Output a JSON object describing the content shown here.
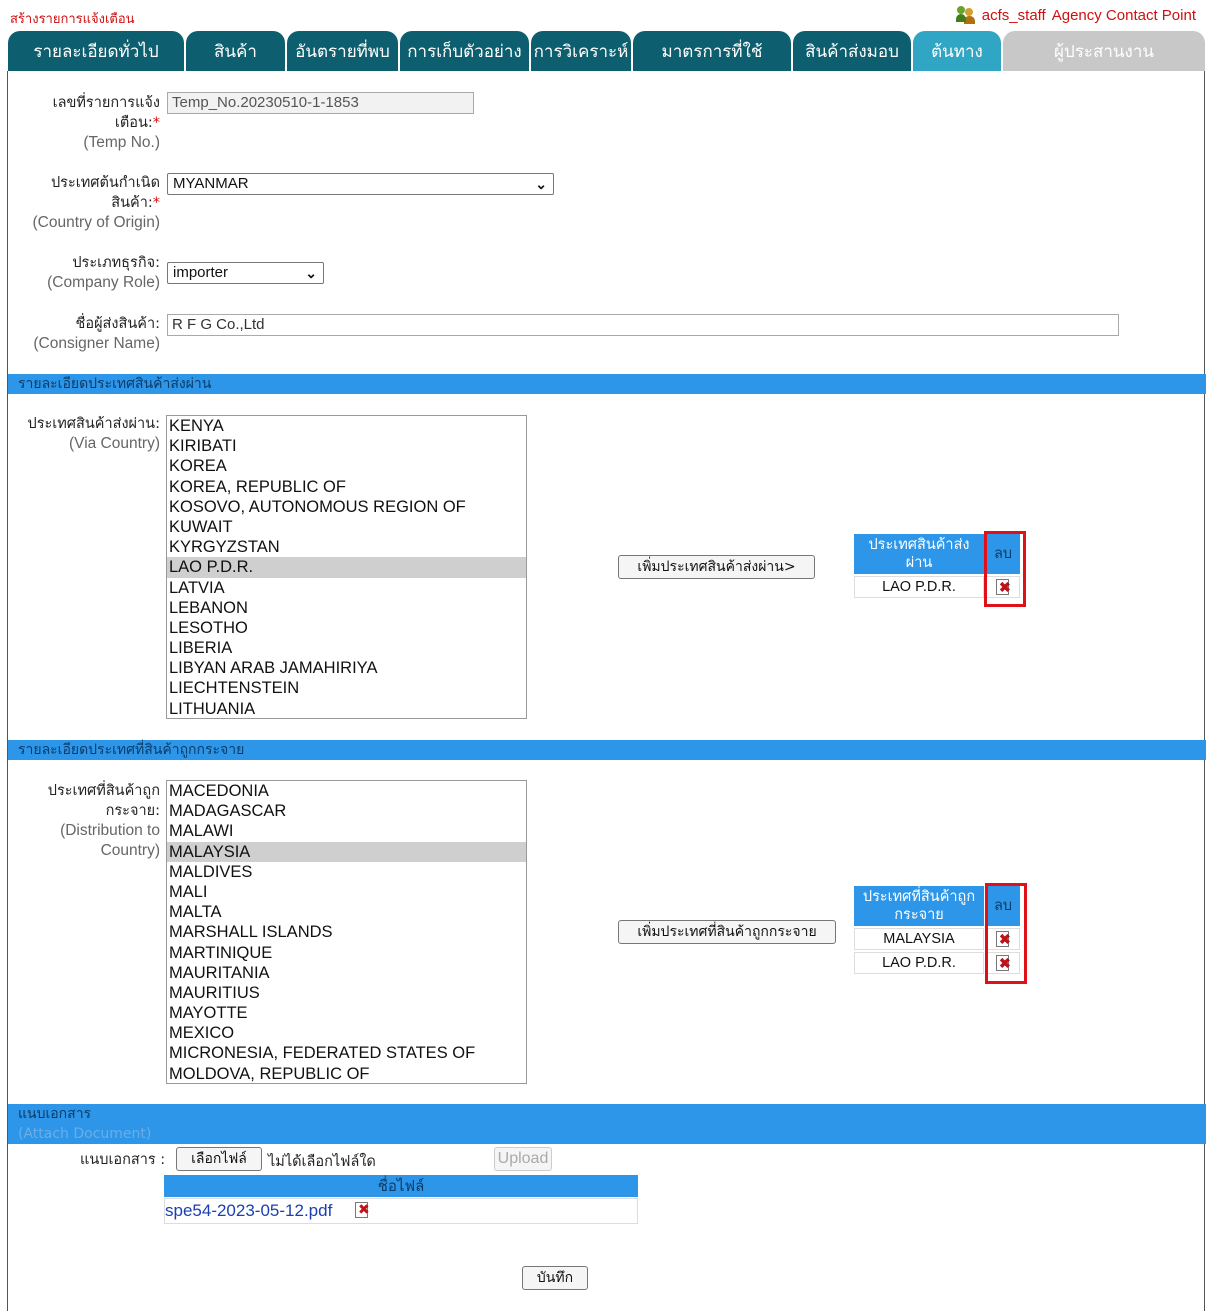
{
  "header": {
    "title": "สร้างรายการแจ้งเตือน",
    "user": "acfs_staff",
    "role": "Agency Contact Point"
  },
  "tabs": [
    {
      "label": "รายละเอียดทั่วไป",
      "state": "normal"
    },
    {
      "label": "สินค้า",
      "state": "normal"
    },
    {
      "label": "อันตรายที่พบ",
      "state": "normal"
    },
    {
      "label": "การเก็บตัวอย่าง",
      "state": "normal"
    },
    {
      "label": "การวิเคราะห์",
      "state": "normal"
    },
    {
      "label": "มาตรการที่ใช้",
      "state": "normal"
    },
    {
      "label": "สินค้าส่งมอบ",
      "state": "normal"
    },
    {
      "label": "ต้นทาง",
      "state": "active"
    },
    {
      "label": "ผู้ประสานงาน",
      "state": "disabled"
    }
  ],
  "form": {
    "temp_no": {
      "label_th": "เลขที่รายการแจ้งเตือน",
      "label_en": "(Temp No.)",
      "value": "Temp_No.20230510-1-1853"
    },
    "origin": {
      "label_th": "ประเทศต้นกำเนิดสินค้า",
      "label_en": "(Country of Origin)",
      "value": "MYANMAR"
    },
    "role": {
      "label_th": "ประเภทธุรกิจ",
      "label_en": "(Company Role)",
      "value": "importer"
    },
    "consigner": {
      "label_th": "ชื่อผู้ส่งสินค้า",
      "label_en": "(Consigner Name)",
      "value": "R F G Co.,Ltd"
    }
  },
  "via": {
    "section_title": "รายละเอียดประเทศสินค้าส่งผ่าน",
    "label_th": "ประเทศสินค้าส่งผ่าน",
    "label_en": "(Via Country)",
    "options": [
      "KENYA",
      "KIRIBATI",
      "KOREA",
      "KOREA, REPUBLIC OF",
      "KOSOVO, AUTONOMOUS REGION OF",
      "KUWAIT",
      "KYRGYZSTAN",
      "LAO P.D.R.",
      "LATVIA",
      "LEBANON",
      "LESOTHO",
      "LIBERIA",
      "LIBYAN ARAB JAMAHIRIYA",
      "LIECHTENSTEIN",
      "LITHUANIA"
    ],
    "selected": "LAO P.D.R.",
    "add_button": "เพิ่มประเทศสินค้าส่งผ่าน>",
    "table_header": "ประเทศสินค้าส่งผ่าน",
    "delete_header": "ลบ",
    "rows": [
      "LAO P.D.R."
    ]
  },
  "dist": {
    "section_title": "รายละเอียดประเทศที่สินค้าถูกกระจาย",
    "label_th": "ประเทศที่สินค้าถูกกระจาย",
    "label_en": "(Distribution to Country)",
    "options": [
      "MACEDONIA",
      "MADAGASCAR",
      "MALAWI",
      "MALAYSIA",
      "MALDIVES",
      "MALI",
      "MALTA",
      "MARSHALL ISLANDS",
      "MARTINIQUE",
      "MAURITANIA",
      "MAURITIUS",
      "MAYOTTE",
      "MEXICO",
      "MICRONESIA, FEDERATED STATES OF",
      "MOLDOVA, REPUBLIC OF"
    ],
    "selected": "MALAYSIA",
    "add_button": "เพิ่มประเทศที่สินค้าถูกกระจาย",
    "table_header": "ประเทศที่สินค้าถูกกระจาย",
    "delete_header": "ลบ",
    "rows": [
      "MALAYSIA",
      "LAO P.D.R."
    ]
  },
  "attach": {
    "section_title": "แนบเอกสาร",
    "section_subtitle": "(Attach Document)",
    "label": "แนบเอกสาร :",
    "choose_button": "เลือกไฟล์",
    "no_file": "ไม่ได้เลือกไฟล์ใด",
    "upload_button": "Upload",
    "table_header": "ชื่อไฟล์",
    "files": [
      "spe54-2023-05-12.pdf"
    ]
  },
  "save_button": "บันทึก",
  "colors": {
    "tab": "#0d5f6f",
    "tab_active": "#30a6c4",
    "section": "#2d96e8",
    "highlight_box": "#e0101a"
  }
}
